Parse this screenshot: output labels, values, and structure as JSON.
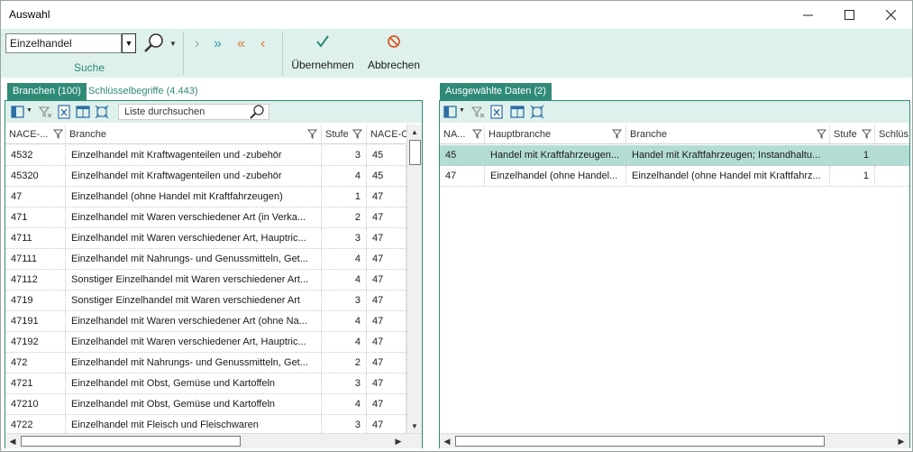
{
  "window": {
    "title": "Auswahl"
  },
  "ribbon": {
    "search_value": "Einzelhandel",
    "search_group_label": "Suche",
    "accept_label": "Übernehmen",
    "cancel_label": "Abbrechen"
  },
  "left": {
    "tabs": [
      {
        "label": "Branchen (100)"
      },
      {
        "label": "Schlüsselbegriffe (4.443)"
      }
    ],
    "filter_placeholder": "Liste durchsuchen",
    "columns": {
      "code": "NACE-...",
      "branche": "Branche",
      "stufe": "Stufe",
      "nace_c": "NACE-C"
    },
    "rows": [
      {
        "code": "4532",
        "branche": "Einzelhandel mit Kraftwagenteilen und -zubehör",
        "stufe": "3",
        "nace_c": "45"
      },
      {
        "code": "45320",
        "branche": "Einzelhandel mit Kraftwagenteilen und -zubehör",
        "stufe": "4",
        "nace_c": "45"
      },
      {
        "code": "47",
        "branche": "Einzelhandel (ohne Handel mit Kraftfahrzeugen)",
        "stufe": "1",
        "nace_c": "47"
      },
      {
        "code": "471",
        "branche": "Einzelhandel mit Waren verschiedener Art (in Verka...",
        "stufe": "2",
        "nace_c": "47"
      },
      {
        "code": "4711",
        "branche": "Einzelhandel mit Waren verschiedener Art, Hauptric...",
        "stufe": "3",
        "nace_c": "47"
      },
      {
        "code": "47111",
        "branche": "Einzelhandel mit Nahrungs- und Genussmitteln, Get...",
        "stufe": "4",
        "nace_c": "47"
      },
      {
        "code": "47112",
        "branche": "Sonstiger Einzelhandel mit Waren verschiedener Art...",
        "stufe": "4",
        "nace_c": "47"
      },
      {
        "code": "4719",
        "branche": "Sonstiger Einzelhandel mit Waren verschiedener Art",
        "stufe": "3",
        "nace_c": "47"
      },
      {
        "code": "47191",
        "branche": "Einzelhandel mit Waren verschiedener Art (ohne Na...",
        "stufe": "4",
        "nace_c": "47"
      },
      {
        "code": "47192",
        "branche": "Einzelhandel mit Waren verschiedener Art, Hauptric...",
        "stufe": "4",
        "nace_c": "47"
      },
      {
        "code": "472",
        "branche": "Einzelhandel mit Nahrungs- und Genussmitteln, Get...",
        "stufe": "2",
        "nace_c": "47"
      },
      {
        "code": "4721",
        "branche": "Einzelhandel mit Obst, Gemüse und Kartoffeln",
        "stufe": "3",
        "nace_c": "47"
      },
      {
        "code": "47210",
        "branche": "Einzelhandel mit Obst, Gemüse und Kartoffeln",
        "stufe": "4",
        "nace_c": "47"
      },
      {
        "code": "4722",
        "branche": "Einzelhandel mit Fleisch und Fleischwaren",
        "stufe": "3",
        "nace_c": "47"
      }
    ]
  },
  "right": {
    "tab": {
      "label": "Ausgewählte Daten (2)"
    },
    "columns": {
      "code": "NA...",
      "hauptbranche": "Hauptbranche",
      "branche": "Branche",
      "stufe": "Stufe",
      "schluessel": "Schlüs"
    },
    "rows": [
      {
        "code": "45",
        "hauptbranche": "Handel mit Kraftfahrzeugen...",
        "branche": "Handel mit Kraftfahrzeugen; Instandhaltu...",
        "stufe": "1",
        "selected": true
      },
      {
        "code": "47",
        "hauptbranche": "Einzelhandel (ohne Handel...",
        "branche": "Einzelhandel (ohne Handel mit Kraftfahrz...",
        "stufe": "1",
        "selected": false
      }
    ]
  },
  "colors": {
    "accent": "#2f8a76",
    "ribbon_bg": "#def1ec",
    "selection": "#b3ddd4"
  }
}
